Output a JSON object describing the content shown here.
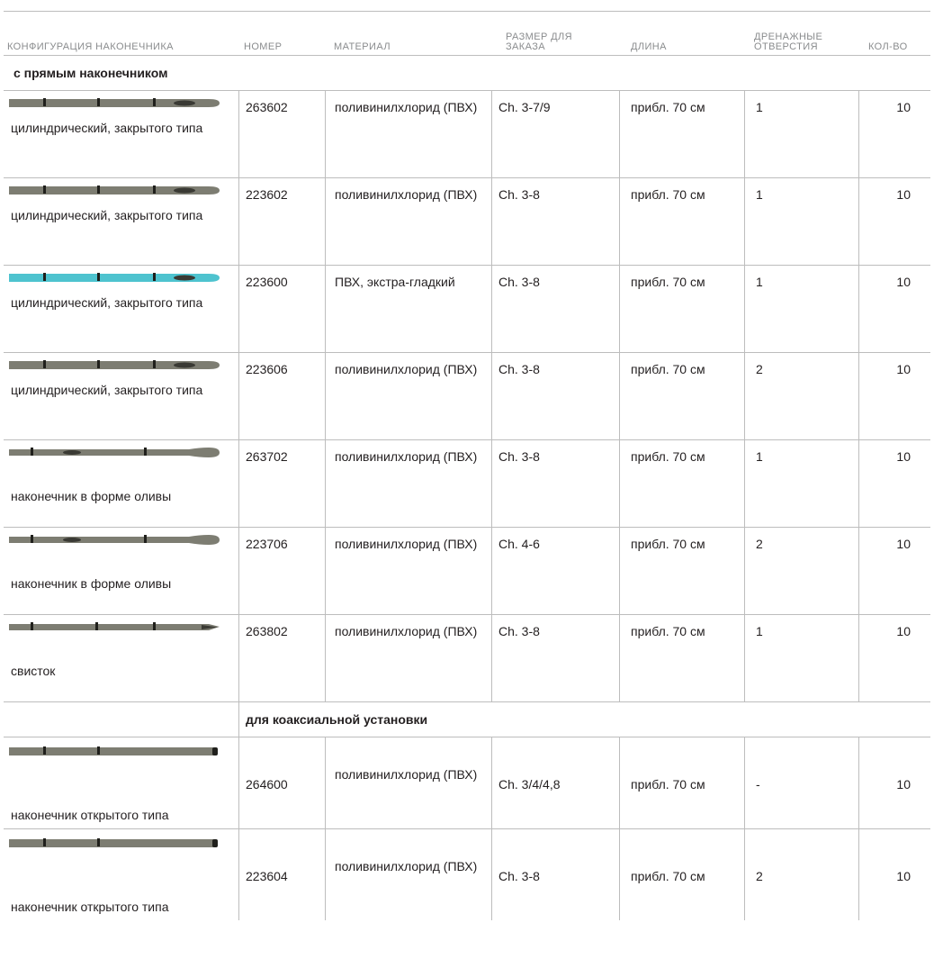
{
  "header": {
    "config": "КОНФИГУРАЦИЯ НАКОНЕЧНИКА",
    "number": "НОМЕР",
    "material": "МАТЕРИАЛ",
    "size": "РАЗМЕР ДЛЯ ЗАКАЗА",
    "length": "ДЛИНА",
    "holes": "ДРЕНАЖНЫЕ ОТВЕРСТИЯ",
    "qty": "КОЛ-ВО"
  },
  "sections": {
    "straight": "с прямым наконечником",
    "coaxial": "для коаксиальной установки"
  },
  "rows": [
    {
      "config": "цилиндрический, закрытого типа",
      "number": "263602",
      "material": "поливинилхлорид (ПВХ)",
      "size": "Ch. 3-7/9",
      "length": "прибл. 70 см",
      "holes": "1",
      "qty": "10",
      "image": "closed-tip-catheter-icon",
      "color": "#7d7d72"
    },
    {
      "config": "цилиндрический, закрытого типа",
      "number": "223602",
      "material": "поливинилхлорид (ПВХ)",
      "size": "Ch. 3-8",
      "length": "прибл. 70 см",
      "holes": "1",
      "qty": "10",
      "image": "closed-tip-catheter-icon",
      "color": "#7d7d72"
    },
    {
      "config": "цилиндрический, закрытого типа",
      "number": "223600",
      "material": "ПВХ, экстра-гладкий",
      "size": "Ch. 3-8",
      "length": "прибл. 70 см",
      "holes": "1",
      "qty": "10",
      "image": "closed-tip-catheter-blue-icon",
      "color": "#4ec3cf"
    },
    {
      "config": "цилиндрический, закрытого типа",
      "number": "223606",
      "material": "поливинилхлорид (ПВХ)",
      "size": "Ch. 3-8",
      "length": "прибл. 70 см",
      "holes": "2",
      "qty": "10",
      "image": "closed-tip-catheter-icon",
      "color": "#7d7d72"
    },
    {
      "config": "наконечник в форме оливы",
      "number": "263702",
      "material": "поливинилхлорид (ПВХ)",
      "size": "Ch. 3-8",
      "length": "прибл. 70 см",
      "holes": "1",
      "qty": "10",
      "image": "olive-tip-catheter-icon",
      "color": "#7d7d72"
    },
    {
      "config": "наконечник в форме оливы",
      "number": "223706",
      "material": "поливинилхлорид (ПВХ)",
      "size": "Ch. 4-6",
      "length": "прибл. 70 см",
      "holes": "2",
      "qty": "10",
      "image": "olive-tip-catheter-icon",
      "color": "#7d7d72"
    },
    {
      "config": "свисток",
      "number": "263802",
      "material": "поливинилхлорид (ПВХ)",
      "size": "Ch. 3-8",
      "length": "прибл. 70 см",
      "holes": "1",
      "qty": "10",
      "image": "whistle-tip-catheter-icon",
      "color": "#7d7d72"
    }
  ],
  "coax_rows": [
    {
      "config": "наконечник открытого типа",
      "number": "264600",
      "material": "поливинилхлорид (ПВХ)",
      "size": "Ch. 3/4/4,8",
      "length": "прибл. 70 см",
      "holes": "-",
      "qty": "10",
      "image": "open-tip-catheter-icon",
      "color": "#7d7d72"
    },
    {
      "config": "наконечник открытого типа",
      "number": "223604",
      "material": "поливинилхлорид (ПВХ)",
      "size": "Ch. 3-8",
      "length": "прибл. 70 см",
      "holes": "2",
      "qty": "10",
      "image": "open-tip-catheter-icon",
      "color": "#7d7d72"
    }
  ]
}
